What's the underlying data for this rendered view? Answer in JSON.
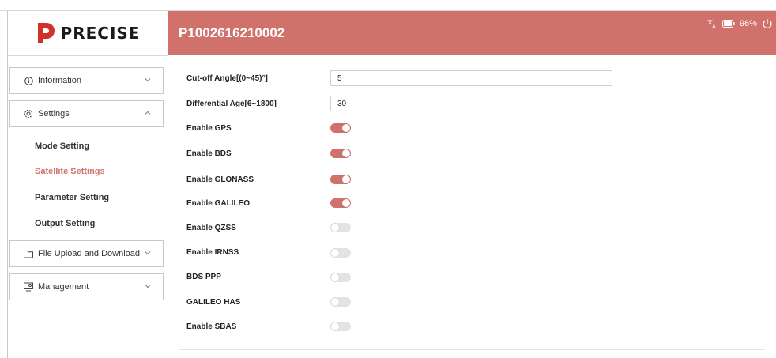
{
  "brand": {
    "logo_text": "PRECISE",
    "accent": "#d0716b"
  },
  "header": {
    "title": "P1002616210002",
    "battery": "96%",
    "icons": [
      "translate-icon",
      "battery-icon",
      "power-icon"
    ]
  },
  "sidebar": {
    "menus": [
      {
        "label": "Information",
        "icon": "info-icon",
        "expanded": false
      },
      {
        "label": "Settings",
        "icon": "settings-icon",
        "expanded": true
      },
      {
        "label": "File Upload and Download",
        "icon": "folder-icon",
        "expanded": false
      },
      {
        "label": "Management",
        "icon": "management-icon",
        "expanded": false
      }
    ],
    "settings_items": [
      {
        "label": "Mode Setting",
        "active": false
      },
      {
        "label": "Satellite Settings",
        "active": true
      },
      {
        "label": "Parameter Setting",
        "active": false
      },
      {
        "label": "Output Setting",
        "active": false
      }
    ]
  },
  "form": {
    "fields": [
      {
        "label": "Cut-off Angle[(0~45)°]",
        "value": "5"
      },
      {
        "label": "Differential Age[6~1800]",
        "value": "30"
      }
    ],
    "toggles": [
      {
        "label": "Enable GPS",
        "on": true
      },
      {
        "label": "Enable BDS",
        "on": true
      },
      {
        "label": "Enable GLONASS",
        "on": true
      },
      {
        "label": "Enable GALILEO",
        "on": true
      },
      {
        "label": "Enable QZSS",
        "on": false
      },
      {
        "label": "Enable IRNSS",
        "on": false
      },
      {
        "label": "BDS PPP",
        "on": false
      },
      {
        "label": "GALILEO HAS",
        "on": false
      },
      {
        "label": "Enable SBAS",
        "on": false
      }
    ]
  }
}
